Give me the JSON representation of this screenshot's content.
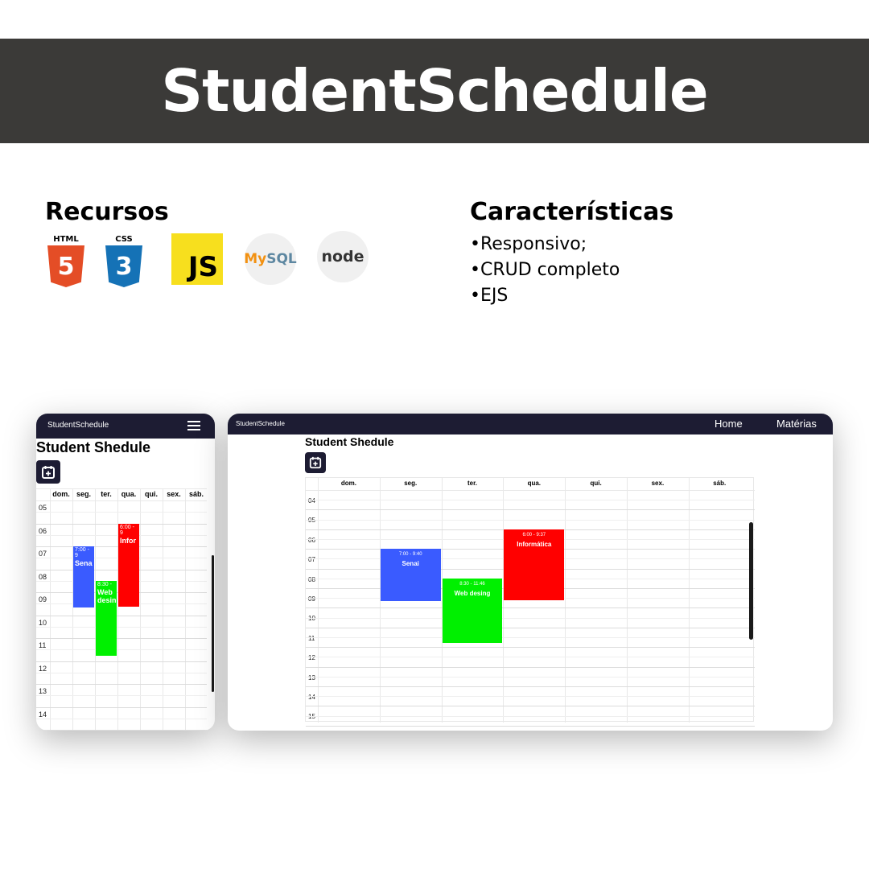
{
  "title": "StudentSchedule",
  "recursos": {
    "heading": "Recursos",
    "logos": [
      {
        "name": "html5-logo",
        "caption": "HTML",
        "glyph": "5",
        "color": "#e44d26"
      },
      {
        "name": "css3-logo",
        "caption": "CSS",
        "glyph": "3",
        "color": "#1572b6"
      },
      {
        "name": "javascript-logo",
        "caption": "JS",
        "color": "#f7df1e"
      },
      {
        "name": "mysql-logo",
        "caption_a": "My",
        "caption_b": "SQL"
      },
      {
        "name": "nodejs-logo",
        "caption": "node"
      }
    ]
  },
  "caracteristicas": {
    "heading": "Características",
    "items": [
      "•Responsivo;",
      "•CRUD completo",
      "•EJS"
    ]
  },
  "app": {
    "brand": "StudentSchedule",
    "page_title": "Student Shedule",
    "nav": [
      "Home",
      "Matérias"
    ],
    "days": [
      "dom.",
      "seg.",
      "ter.",
      "qua.",
      "qui.",
      "sex.",
      "sáb."
    ],
    "mobile_hours": [
      "05",
      "06",
      "07",
      "08",
      "09",
      "10",
      "11",
      "12",
      "13",
      "14"
    ],
    "desktop_hours": [
      "04",
      "05",
      "06",
      "07",
      "08",
      "09",
      "10",
      "11",
      "12",
      "13",
      "14",
      "15"
    ],
    "mobile_events": [
      {
        "name": "Sena",
        "time": "7:00 - 9",
        "day": 1,
        "start": 7.0,
        "end": 9.67,
        "color": "#3a5bff"
      },
      {
        "name": "Web desin",
        "time": "8:30 -",
        "day": 2,
        "start": 8.5,
        "end": 11.77,
        "color": "#00f000"
      },
      {
        "name": "Infor",
        "time": "6:00 - 9",
        "day": 3,
        "start": 6.0,
        "end": 9.62,
        "color": "#ff0000"
      }
    ],
    "desktop_events": [
      {
        "name": "Senai",
        "time": "7:00 - 9:40",
        "day": 1,
        "start": 7.0,
        "end": 9.67,
        "color": "#3a5bff"
      },
      {
        "name": "Web desing",
        "time": "8:30 - 11:46",
        "day": 2,
        "start": 8.5,
        "end": 11.77,
        "color": "#00f000"
      },
      {
        "name": "Informática",
        "time": "6:00 - 9:37",
        "day": 3,
        "start": 6.0,
        "end": 9.62,
        "color": "#ff0000"
      }
    ]
  },
  "colors": {
    "banner": "#3b3a38",
    "navbar": "#1d1c33"
  }
}
